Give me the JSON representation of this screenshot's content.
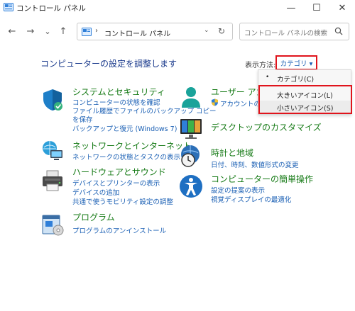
{
  "window": {
    "title": "コントロール パネル",
    "buttons": {
      "minimize": "—",
      "maximize": "☐",
      "close": "✕"
    }
  },
  "nav": {
    "back": "←",
    "forward": "→",
    "recent": "⌄",
    "up": "↑",
    "address_chevron": "›",
    "address_text": "コントロール パネル",
    "address_dropdown": "⌄",
    "refresh": "↻",
    "search_placeholder": "コントロール パネルの検索"
  },
  "main": {
    "heading": "コンピューターの設定を調整します",
    "view_by_label": "表示方法:",
    "view_by_value": "カテゴリ ▾"
  },
  "view_menu": {
    "items": [
      {
        "label": "カテゴリ(C)",
        "bullet": "•"
      },
      {
        "label": "大きいアイコン(L)"
      },
      {
        "label": "小さいアイコン(S)"
      }
    ]
  },
  "categories_left": [
    {
      "title": "システムとセキュリティ",
      "links": [
        "コンピューターの状態を確認",
        "ファイル履歴でファイルのバックアップ コピー",
        "を保存",
        "バックアップと復元 (Windows 7)"
      ],
      "icon": "shield-icon"
    },
    {
      "title": "ネットワークとインターネット",
      "links": [
        "ネットワークの状態とタスクの表示"
      ],
      "icon": "network-icon"
    },
    {
      "title": "ハードウェアとサウンド",
      "links": [
        "デバイスとプリンターの表示",
        "デバイスの追加",
        "共通で使うモビリティ設定の調整"
      ],
      "icon": "printer-icon"
    },
    {
      "title": "プログラム",
      "links": [
        "プログラムのアンインストール"
      ],
      "icon": "programs-icon"
    }
  ],
  "categories_right": [
    {
      "title": "ユーザー アカウ",
      "links": [
        "アカウントの種"
      ],
      "icon": "user-icon"
    },
    {
      "title": "デスクトップのカスタマイズ",
      "links": [],
      "icon": "desktop-icon"
    },
    {
      "title": "時計と地域",
      "links": [
        "日付、時刻、数値形式の変更"
      ],
      "icon": "clock-icon"
    },
    {
      "title": "コンピューターの簡単操作",
      "links": [
        "設定の提案の表示",
        "視覚ディスプレイの最適化"
      ],
      "icon": "accessibility-icon"
    }
  ],
  "colors": {
    "category_title": "#157a15",
    "link": "#1a5fb4",
    "heading": "#1a3a8c",
    "highlight": "#e0141c"
  }
}
